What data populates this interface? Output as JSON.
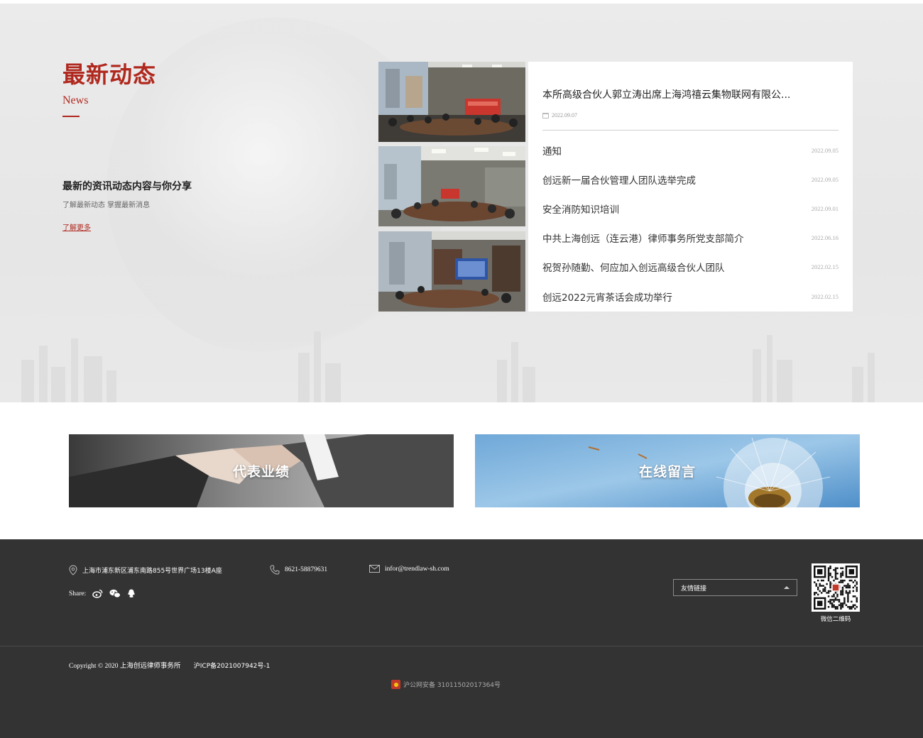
{
  "news": {
    "title": "最新动态",
    "subtitle": "News",
    "slogan": "最新的资讯动态内容与你分享",
    "description": "了解最新动态 掌握最新消息",
    "more_label": "了解更多",
    "featured": {
      "title": "本所高级合伙人郭立涛出席上海鸿禧云集物联网有限公...",
      "date": "2022.09.07"
    },
    "items": [
      {
        "title": "通知",
        "date": "2022.09.05"
      },
      {
        "title": "创远新一届合伙管理人团队选举完成",
        "date": "2022.09.05"
      },
      {
        "title": "安全消防知识培训",
        "date": "2022.09.01"
      },
      {
        "title": "中共上海创远（连云港）律师事务所党支部简介",
        "date": "2022.06.16"
      },
      {
        "title": "祝贺孙随勤、何应加入创远高级合伙人团队",
        "date": "2022.02.15"
      },
      {
        "title": "创远2022元宵茶话会成功举行",
        "date": "2022.02.15"
      }
    ]
  },
  "banners": {
    "left_label": "代表业绩",
    "right_label": "在线留言"
  },
  "footer": {
    "address": "上海市浦东新区浦东南路855号世界广场13楼A座",
    "phone": "8621-58879631",
    "email": "infor@trendlaw-sh.com",
    "share_label": "Share:",
    "links_label": "友情链接",
    "qr_caption": "微信二维码",
    "copyright": "Copyright © 2020",
    "company": "上海创远律师事务所",
    "icp": "沪ICP备2021007942号-1",
    "police": "沪公网安备 31011502017364号"
  },
  "colors": {
    "accent": "#b0281e",
    "footer_bg": "#333333"
  },
  "icons": {
    "address": "location-pin-icon",
    "phone": "phone-icon",
    "email": "envelope-icon",
    "share": [
      "weibo-icon",
      "wechat-icon",
      "qq-icon"
    ],
    "dropdown": "caret-up-icon"
  }
}
